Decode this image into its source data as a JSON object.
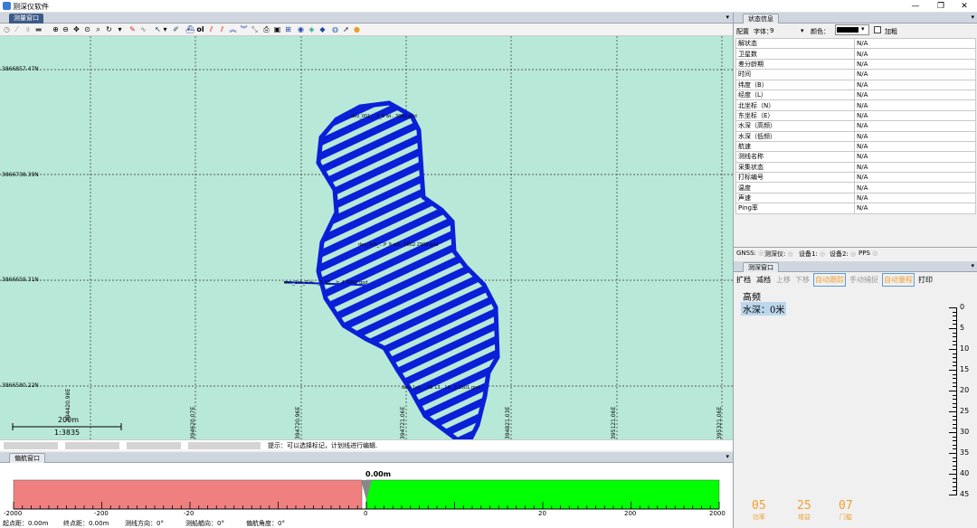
{
  "window": {
    "title": "测深仪软件",
    "minimize": "—",
    "restore": "❐",
    "close": "✕"
  },
  "survey_panel": {
    "tab": "测量窗口",
    "northing_labels": [
      "3866857.47N",
      "3866738.39N",
      "3866659.31N",
      "3866580.22N"
    ],
    "easting_labels": [
      "394420.98E",
      "394620.07E",
      "394720.96E",
      "394721.06E",
      "394821.03E",
      "395121.06E",
      "395321.06E"
    ],
    "scale_bar": {
      "length_label": "200m",
      "ratio": "1:3835"
    },
    "track_labels": [
      "dev_001_...P_9 wl...3002.god",
      "dev_1ch_0 tv..._5 18 ...lc_1 2002.god",
      "dev_1ch_...P_9 w3...1602 2903.god",
      "dev_1ch_...lt5 13...14._3 2501.god"
    ],
    "hint": "提示：可以选择标记，计划线进行编辑."
  },
  "status_panel": {
    "tab": "状态信息",
    "config_label": "配置",
    "font_label": "字体：",
    "font_value": "9",
    "color_label": "颜色：",
    "bold_label": "加粗",
    "rows": [
      {
        "name": "解状态",
        "value": "N/A"
      },
      {
        "name": "卫星数",
        "value": "N/A"
      },
      {
        "name": "差分龄期",
        "value": "N/A"
      },
      {
        "name": "时间",
        "value": "N/A"
      },
      {
        "name": "纬度（B）",
        "value": "N/A"
      },
      {
        "name": "经度（L）",
        "value": "N/A"
      },
      {
        "name": "北坐标（N）",
        "value": "N/A"
      },
      {
        "name": "东坐标（E）",
        "value": "N/A"
      },
      {
        "name": "水深（高频）",
        "value": "N/A"
      },
      {
        "name": "水深（低频）",
        "value": "N/A"
      },
      {
        "name": "航速",
        "value": "N/A"
      },
      {
        "name": "测线名称",
        "value": "N/A"
      },
      {
        "name": "采集状态",
        "value": "N/A"
      },
      {
        "name": "打标编号",
        "value": "N/A"
      },
      {
        "name": "温度",
        "value": "N/A"
      },
      {
        "name": "声速",
        "value": "N/A"
      },
      {
        "name": "Ping率",
        "value": "N/A"
      }
    ],
    "devices": [
      "GNSS:",
      "测深仪:",
      "设备1:",
      "设备2:",
      "PPS"
    ]
  },
  "sounder_panel": {
    "tab": "测深窗口",
    "buttons": {
      "expand": "扩档",
      "reduce": "减档",
      "up": "上移",
      "down": "下移",
      "auto_track": "自动跟踪",
      "manual_capture": "手动捕捉",
      "auto_range": "自动量程",
      "print": "打印"
    },
    "frequency": "高频",
    "depth": "水深：0米",
    "ruler_labels": [
      "0",
      "5",
      "10",
      "15",
      "20",
      "25",
      "30",
      "35",
      "40",
      "45"
    ],
    "readouts": [
      {
        "value": "05",
        "label": "功率"
      },
      {
        "value": "25",
        "label": "增益"
      },
      {
        "value": "07",
        "label": "门槛"
      }
    ]
  },
  "deviation_panel": {
    "tab": "偏航窗口",
    "value": "0.00m",
    "axis_labels": [
      "-2000",
      "-200",
      "-20",
      "0",
      "20",
      "200",
      "2000"
    ],
    "stats": [
      {
        "label": "起点距：",
        "value": "0.00m"
      },
      {
        "label": "终点距：",
        "value": "0.00m"
      },
      {
        "label": "测线方向：",
        "value": "0°"
      },
      {
        "label": "测船艏向：",
        "value": "0°"
      },
      {
        "label": "偏航角度：",
        "value": "0°"
      }
    ]
  }
}
